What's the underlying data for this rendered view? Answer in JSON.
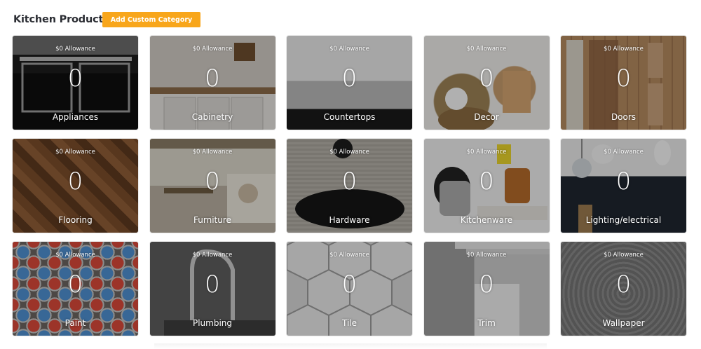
{
  "header": {
    "title": "Kitchen Products",
    "add_button": "Add Custom Category"
  },
  "tiles": [
    {
      "id": "appliances",
      "label": "Appliances",
      "allowance": "$0 Allowance",
      "count": "0",
      "image": "stove-range-image",
      "bg": "#9a9a9a"
    },
    {
      "id": "cabinetry",
      "label": "Cabinetry",
      "allowance": "$0 Allowance",
      "count": "0",
      "image": "kitchen-cabinets-image",
      "bg": "#a7a29c"
    },
    {
      "id": "countertops",
      "label": "Countertops",
      "allowance": "$0 Allowance",
      "count": "0",
      "image": "kitchen-island-image",
      "bg": "#9c9c9c"
    },
    {
      "id": "decor",
      "label": "Decor",
      "allowance": "$0 Allowance",
      "count": "0",
      "image": "utensils-basket-image",
      "bg": "#b7ab9a"
    },
    {
      "id": "doors",
      "label": "Doors",
      "allowance": "$0 Allowance",
      "count": "0",
      "image": "wooden-doors-image",
      "bg": "#b08a66"
    },
    {
      "id": "flooring",
      "label": "Flooring",
      "allowance": "$0 Allowance",
      "count": "0",
      "image": "herringbone-wood-image",
      "bg": "#7a4f2d"
    },
    {
      "id": "furniture",
      "label": "Furniture",
      "allowance": "$0 Allowance",
      "count": "0",
      "image": "dining-nook-image",
      "bg": "#a49c8c"
    },
    {
      "id": "hardware",
      "label": "Hardware",
      "allowance": "$0 Allowance",
      "count": "0",
      "image": "cabinet-pull-image",
      "bg": "#8c8982"
    },
    {
      "id": "kitchenware",
      "label": "Kitchenware",
      "allowance": "$0 Allowance",
      "count": "0",
      "image": "pots-pans-image",
      "bg": "#a9a5a0"
    },
    {
      "id": "lighting",
      "label": "Lighting/electrical",
      "allowance": "$0 Allowance",
      "count": "0",
      "image": "pendant-lights-image",
      "bg": "#3b3f46"
    },
    {
      "id": "paint",
      "label": "Paint",
      "allowance": "$0 Allowance",
      "count": "0",
      "image": "paint-cans-image",
      "bg": "#7b6f6a"
    },
    {
      "id": "plumbing",
      "label": "Plumbing",
      "allowance": "$0 Allowance",
      "count": "0",
      "image": "faucet-image",
      "bg": "#5e5e5e"
    },
    {
      "id": "tile",
      "label": "Tile",
      "allowance": "$0 Allowance",
      "count": "0",
      "image": "hexagon-tile-image",
      "bg": "#c9c9c9"
    },
    {
      "id": "trim",
      "label": "Trim",
      "allowance": "$0 Allowance",
      "count": "0",
      "image": "crown-molding-image",
      "bg": "#a6a6a6"
    },
    {
      "id": "wallpaper",
      "label": "Wallpaper",
      "allowance": "$0 Allowance",
      "count": "0",
      "image": "pattern-wallpaper-image",
      "bg": "#7d7d7d"
    }
  ],
  "colors": {
    "accent": "#f8a61b",
    "title_text": "#2b2d33"
  }
}
